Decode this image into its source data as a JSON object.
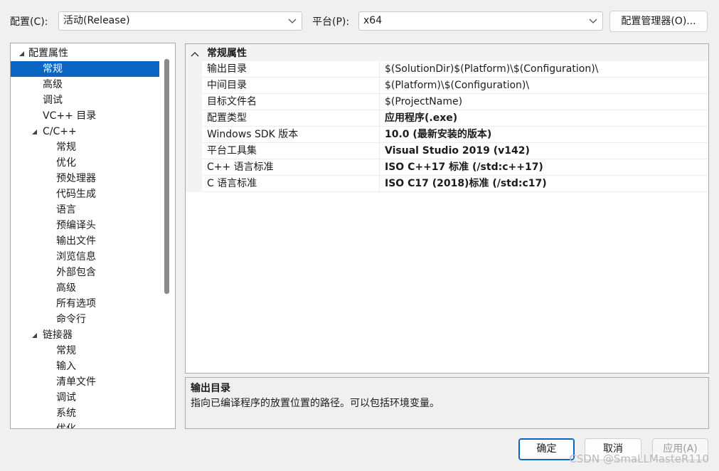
{
  "topbar": {
    "config_label": "配置(C):",
    "config_value": "活动(Release)",
    "platform_label": "平台(P):",
    "platform_value": "x64",
    "config_manager_button": "配置管理器(O)..."
  },
  "tree": {
    "items": [
      {
        "label": "配置属性",
        "level": 0,
        "expander": "expanded",
        "selected": false
      },
      {
        "label": "常规",
        "level": 1,
        "expander": "none",
        "selected": true
      },
      {
        "label": "高级",
        "level": 1,
        "expander": "none",
        "selected": false
      },
      {
        "label": "调试",
        "level": 1,
        "expander": "none",
        "selected": false
      },
      {
        "label": "VC++ 目录",
        "level": 1,
        "expander": "none",
        "selected": false
      },
      {
        "label": "C/C++",
        "level": 1,
        "expander": "expanded",
        "selected": false
      },
      {
        "label": "常规",
        "level": 2,
        "expander": "none",
        "selected": false
      },
      {
        "label": "优化",
        "level": 2,
        "expander": "none",
        "selected": false
      },
      {
        "label": "预处理器",
        "level": 2,
        "expander": "none",
        "selected": false
      },
      {
        "label": "代码生成",
        "level": 2,
        "expander": "none",
        "selected": false
      },
      {
        "label": "语言",
        "level": 2,
        "expander": "none",
        "selected": false
      },
      {
        "label": "预编译头",
        "level": 2,
        "expander": "none",
        "selected": false
      },
      {
        "label": "输出文件",
        "level": 2,
        "expander": "none",
        "selected": false
      },
      {
        "label": "浏览信息",
        "level": 2,
        "expander": "none",
        "selected": false
      },
      {
        "label": "外部包含",
        "level": 2,
        "expander": "none",
        "selected": false
      },
      {
        "label": "高级",
        "level": 2,
        "expander": "none",
        "selected": false
      },
      {
        "label": "所有选项",
        "level": 2,
        "expander": "none",
        "selected": false
      },
      {
        "label": "命令行",
        "level": 2,
        "expander": "none",
        "selected": false
      },
      {
        "label": "链接器",
        "level": 1,
        "expander": "expanded",
        "selected": false
      },
      {
        "label": "常规",
        "level": 2,
        "expander": "none",
        "selected": false
      },
      {
        "label": "输入",
        "level": 2,
        "expander": "none",
        "selected": false
      },
      {
        "label": "清单文件",
        "level": 2,
        "expander": "none",
        "selected": false
      },
      {
        "label": "调试",
        "level": 2,
        "expander": "none",
        "selected": false
      },
      {
        "label": "系统",
        "level": 2,
        "expander": "none",
        "selected": false
      },
      {
        "label": "优化",
        "level": 2,
        "expander": "none",
        "selected": false
      }
    ]
  },
  "grid": {
    "category": "常规属性",
    "rows": [
      {
        "name": "输出目录",
        "value": "$(SolutionDir)$(Platform)\\$(Configuration)\\",
        "bold": false
      },
      {
        "name": "中间目录",
        "value": "$(Platform)\\$(Configuration)\\",
        "bold": false
      },
      {
        "name": "目标文件名",
        "value": "$(ProjectName)",
        "bold": false
      },
      {
        "name": "配置类型",
        "value": "应用程序(.exe)",
        "bold": true
      },
      {
        "name": "Windows SDK 版本",
        "value": "10.0 (最新安装的版本)",
        "bold": true
      },
      {
        "name": "平台工具集",
        "value": "Visual Studio 2019 (v142)",
        "bold": true
      },
      {
        "name": "C++ 语言标准",
        "value": "ISO C++17 标准 (/std:c++17)",
        "bold": true
      },
      {
        "name": "C 语言标准",
        "value": "ISO C17 (2018)标准 (/std:c17)",
        "bold": true
      }
    ]
  },
  "description": {
    "title": "输出目录",
    "text": "指向已编译程序的放置位置的路径。可以包括环境变量。"
  },
  "footer": {
    "ok_button": "确定",
    "cancel_button": "取消",
    "apply_button": "应用(A)"
  },
  "watermark": "CSDN @SmaLLMasteR110",
  "colors": {
    "selection": "#0a64c2",
    "window_bg": "#f0f0f0",
    "disabled_text": "#9a9a9a",
    "ok_border": "#0a64c2"
  }
}
